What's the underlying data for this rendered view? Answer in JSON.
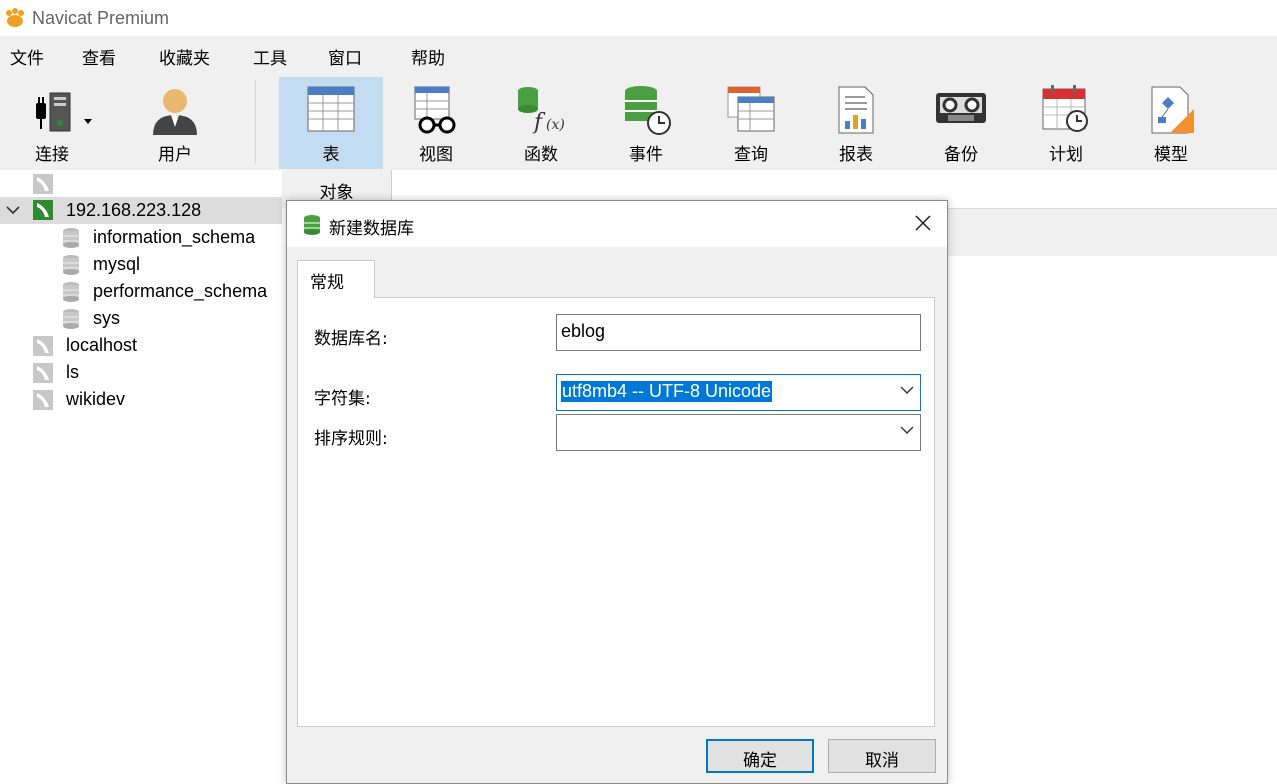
{
  "window": {
    "title": "Navicat Premium"
  },
  "menu": [
    "文件",
    "查看",
    "收藏夹",
    "工具",
    "窗口",
    "帮助"
  ],
  "toolbar": {
    "connect": "连接",
    "user": "用户",
    "table": "表",
    "view": "视图",
    "function": "函数",
    "event": "事件",
    "query": "查询",
    "report": "报表",
    "backup": "备份",
    "schedule": "计划",
    "model": "模型"
  },
  "tree": {
    "connections": [
      {
        "name": "192.168.223.128",
        "expanded": true,
        "databases": [
          "information_schema",
          "mysql",
          "performance_schema",
          "sys"
        ]
      },
      {
        "name": "localhost"
      },
      {
        "name": "ls"
      },
      {
        "name": "wikidev"
      }
    ]
  },
  "objects": {
    "tab": "对象"
  },
  "dialog": {
    "title": "新建数据库",
    "tab": "常规",
    "db_name_label": "数据库名:",
    "db_name_value": "eblog",
    "charset_label": "字符集:",
    "charset_value": "utf8mb4 -- UTF-8 Unicode",
    "collation_label": "排序规则:",
    "collation_value": "",
    "ok": "确定",
    "cancel": "取消"
  },
  "colors": {
    "accent": "#0078d7",
    "toolbar_active": "#c4dcf2",
    "mysql_green": "#2e8b2e"
  }
}
